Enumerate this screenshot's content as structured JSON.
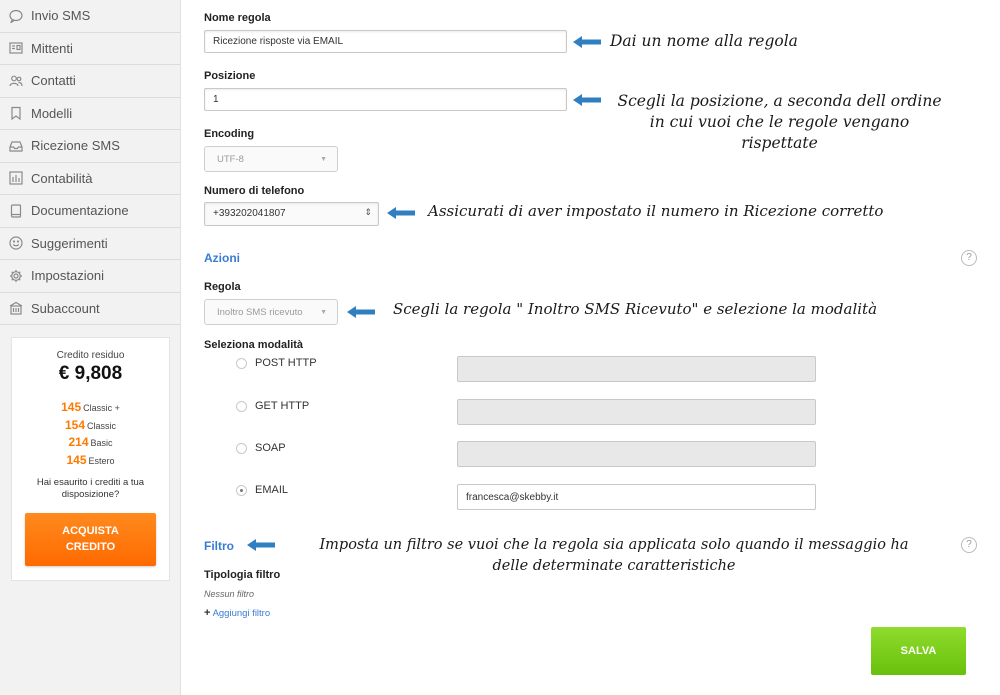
{
  "sidebar": {
    "items": [
      {
        "label": "Invio SMS",
        "icon": "chat-bubble-icon"
      },
      {
        "label": "Mittenti",
        "icon": "id-card-icon"
      },
      {
        "label": "Contatti",
        "icon": "people-icon"
      },
      {
        "label": "Modelli",
        "icon": "bookmark-icon"
      },
      {
        "label": "Ricezione SMS",
        "icon": "inbox-icon"
      },
      {
        "label": "Contabilità",
        "icon": "bar-chart-icon"
      },
      {
        "label": "Documentazione",
        "icon": "book-icon"
      },
      {
        "label": "Suggerimenti",
        "icon": "smiley-icon"
      },
      {
        "label": "Impostazioni",
        "icon": "gear-icon"
      },
      {
        "label": "Subaccount",
        "icon": "building-icon"
      }
    ],
    "credit": {
      "title": "Credito residuo",
      "value": "€ 9,808",
      "rows": [
        {
          "num": "145",
          "label": "Classic +"
        },
        {
          "num": "154",
          "label": "Classic"
        },
        {
          "num": "214",
          "label": "Basic"
        },
        {
          "num": "145",
          "label": "Estero"
        }
      ],
      "question": "Hai esaurito i crediti a tua disposizione?",
      "buy_line1": "ACQUISTA",
      "buy_line2": "CREDITO"
    }
  },
  "form": {
    "name_label": "Nome regola",
    "name_value": "Ricezione risposte via EMAIL",
    "position_label": "Posizione",
    "position_value": "1",
    "encoding_label": "Encoding",
    "encoding_value": "UTF-8",
    "phone_label": "Numero di telefono",
    "phone_value": "+393202041807",
    "actions_title": "Azioni",
    "rule_label": "Regola",
    "rule_value": "Inoltro SMS ricevuto",
    "mode_label": "Seleziona modalità",
    "modes": [
      {
        "label": "POST HTTP",
        "value": "",
        "checked": false
      },
      {
        "label": "GET HTTP",
        "value": "",
        "checked": false
      },
      {
        "label": "SOAP",
        "value": "",
        "checked": false
      },
      {
        "label": "EMAIL",
        "value": "francesca@skebby.it",
        "checked": true
      }
    ],
    "filter_title": "Filtro",
    "filter_type_label": "Tipologia filtro",
    "no_filter": "Nessun filtro",
    "add_filter": "Aggiungi filtro",
    "save_label": "SALVA",
    "help_glyph": "?"
  },
  "annotations": {
    "name": "Dai un nome alla regola",
    "position_line1": "Scegli la posizione, a seconda dell ordine",
    "position_line2": "in cui vuoi che le regole vengano",
    "position_line3": "rispettate",
    "phone": "Assicurati di aver impostato il numero in Ricezione corretto",
    "rule": "Scegli la regola \" Inoltro SMS Ricevuto\"  e selezione la modalità",
    "filter_line1": "Imposta un filtro se vuoi che la regola sia applicata solo quando il messaggio ha",
    "filter_line2": "delle determinate caratteristiche"
  },
  "colors": {
    "accent_blue": "#3a7bd5",
    "arrow_blue": "#2f7fc1",
    "orange": "#ff7a00",
    "green": "#7ccf1f"
  }
}
